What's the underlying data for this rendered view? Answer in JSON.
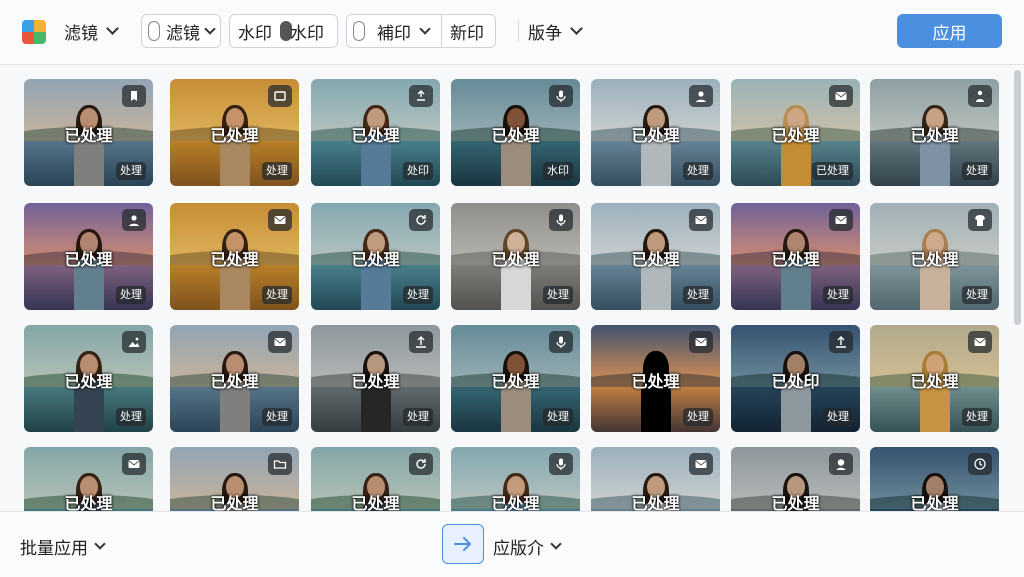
{
  "toolbar": {
    "filter_menu": "滤镜",
    "filter_dropdown": "滤镜",
    "watermark_a": "水印",
    "watermark_b": "水印",
    "overlay_item": "補印",
    "new_item": "新印",
    "version_menu": "版争",
    "apply_button": "应用"
  },
  "tiles": [
    {
      "label": "已处理",
      "badge": "处理",
      "icon": "bookmark-icon",
      "theme": "lake-dusk"
    },
    {
      "label": "已处理",
      "badge": "处理",
      "icon": "frame-icon",
      "theme": "golden"
    },
    {
      "label": "已处理",
      "badge": "处印",
      "icon": "export-icon",
      "theme": "teal"
    },
    {
      "label": "已处理",
      "badge": "水印",
      "icon": "mic-icon",
      "theme": "dark-teal"
    },
    {
      "label": "已处理",
      "badge": "处理",
      "icon": "user-icon",
      "theme": "cool"
    },
    {
      "label": "已处理",
      "badge": "已处理",
      "icon": "mail-icon",
      "theme": "warm-teal"
    },
    {
      "label": "已处理",
      "badge": "处理",
      "icon": "person-wave-icon",
      "theme": "pier"
    },
    {
      "label": "已处理",
      "badge": "处理",
      "icon": "user-icon",
      "theme": "sunset-pink"
    },
    {
      "label": "已处理",
      "badge": "处理",
      "icon": "mail-icon",
      "theme": "golden"
    },
    {
      "label": "已处理",
      "badge": "处理",
      "icon": "refresh-icon",
      "theme": "teal"
    },
    {
      "label": "已处理",
      "badge": "处理",
      "icon": "mic-icon",
      "theme": "corridor"
    },
    {
      "label": "已处理",
      "badge": "处理",
      "icon": "mail-icon",
      "theme": "cool"
    },
    {
      "label": "已处理",
      "badge": "处理",
      "icon": "mail-icon",
      "theme": "sunset-pink"
    },
    {
      "label": "已处理",
      "badge": "处理",
      "icon": "shirt-icon",
      "theme": "wind"
    },
    {
      "label": "已处理",
      "badge": "处理",
      "icon": "landscape-icon",
      "theme": "teal-green"
    },
    {
      "label": "已处理",
      "badge": "处理",
      "icon": "mail-icon",
      "theme": "lake-dusk"
    },
    {
      "label": "已处理",
      "badge": "处理",
      "icon": "upload-icon",
      "theme": "grey"
    },
    {
      "label": "已处理",
      "badge": "处理",
      "icon": "mic-icon",
      "theme": "dark-teal"
    },
    {
      "label": "已处理",
      "badge": "处理",
      "icon": "mail-icon",
      "theme": "orange-sunset"
    },
    {
      "label": "已处印",
      "badge": "处理",
      "icon": "upload-icon",
      "theme": "blue-dark"
    },
    {
      "label": "已处理",
      "badge": "处理",
      "icon": "mail-icon",
      "theme": "golden-lake"
    },
    {
      "label": "已处理",
      "badge": "",
      "icon": "mail-icon",
      "theme": "teal-green"
    },
    {
      "label": "已处理",
      "badge": "",
      "icon": "folder-icon",
      "theme": "lake-dusk"
    },
    {
      "label": "已处理",
      "badge": "",
      "icon": "refresh-icon",
      "theme": "teal-green"
    },
    {
      "label": "已处理",
      "badge": "",
      "icon": "mic-icon",
      "theme": "teal"
    },
    {
      "label": "已处理",
      "badge": "",
      "icon": "mail-icon",
      "theme": "cool"
    },
    {
      "label": "已处理",
      "badge": "",
      "icon": "person-icon",
      "theme": "grey"
    },
    {
      "label": "已处理",
      "badge": "",
      "icon": "clock-icon",
      "theme": "blue-dark"
    }
  ],
  "bottom": {
    "batch_apply": "批量应用",
    "version_menu": "应版介"
  },
  "colors": {
    "accent": "#4a8fe0",
    "background": "#f7f8fa"
  }
}
